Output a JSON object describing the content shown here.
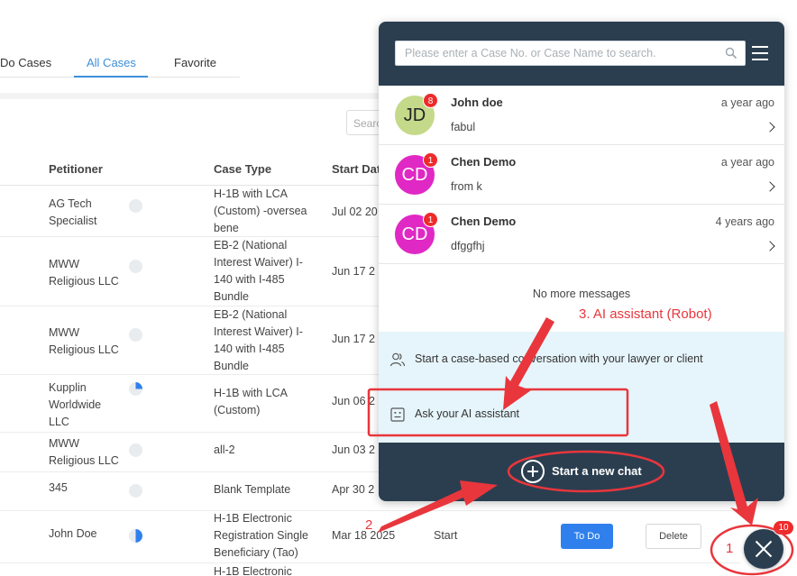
{
  "tabs": {
    "todo": "Do Cases",
    "all": "All Cases",
    "favorite": "Favorite"
  },
  "bg_search": {
    "placeholder": "Searc"
  },
  "table": {
    "headers": {
      "petitioner": "Petitioner",
      "case_type": "Case Type",
      "start_date": "Start Dat"
    },
    "rows": [
      {
        "petitioner": "AG Tech Specialist",
        "case_type": "H-1B with LCA (Custom) -oversea bene",
        "start": "Jul 02 20",
        "progress": 0
      },
      {
        "petitioner": "MWW Religious LLC",
        "case_type": "EB-2 (National Interest Waiver) I-140 with I-485 Bundle",
        "start": "Jun 17 2",
        "progress": 0
      },
      {
        "petitioner": "MWW Religious LLC",
        "case_type": "EB-2 (National Interest Waiver) I-140 with I-485 Bundle",
        "start": "Jun 17 2",
        "progress": 0
      },
      {
        "petitioner": "Kupplin Worldwide LLC",
        "case_type": "H-1B with LCA (Custom)",
        "start": "Jun 06 2",
        "progress": 0.25
      },
      {
        "petitioner": "MWW Religious LLC",
        "case_type": "all-2",
        "start": "Jun 03 2",
        "progress": 0
      },
      {
        "petitioner": "345",
        "case_type": "Blank Template",
        "start": "Apr 30 2",
        "progress": 0
      },
      {
        "petitioner": "John Doe",
        "case_type": "H-1B Electronic Registration Single Beneficiary (Tao)",
        "start": "Mar 18 2025",
        "progress": 0.5,
        "status": "Start",
        "todo": "To Do",
        "delete": "Delete"
      },
      {
        "petitioner": "",
        "case_type": "H-1B Electronic",
        "start": "",
        "progress": 0
      }
    ]
  },
  "chat": {
    "search_placeholder": "Please enter a Case No. or Case Name to search.",
    "conversations": [
      {
        "initials": "JD",
        "name": "John doe",
        "time": "a year ago",
        "message": "fabul",
        "unread": "8",
        "avatar_color": "#c5d98a",
        "initials_color": "#222222"
      },
      {
        "initials": "CD",
        "name": "Chen Demo",
        "time": "a year ago",
        "message": "from k",
        "unread": "1",
        "avatar_color": "#e028c4",
        "initials_color": "#ffffff"
      },
      {
        "initials": "CD",
        "name": "Chen Demo",
        "time": "4 years ago",
        "message": "dfggfhj",
        "unread": "1",
        "avatar_color": "#e028c4",
        "initials_color": "#ffffff"
      }
    ],
    "no_more": "No more messages",
    "option_case": "Start a case-based conversation with your lawyer or client",
    "option_ai": "Ask your AI assistant",
    "new_chat": "Start a new chat"
  },
  "fab": {
    "badge": "10"
  },
  "annotations": {
    "label1": "1",
    "label2": "2",
    "label3": "3. AI assistant (Robot)",
    "color": "#e8363c"
  }
}
